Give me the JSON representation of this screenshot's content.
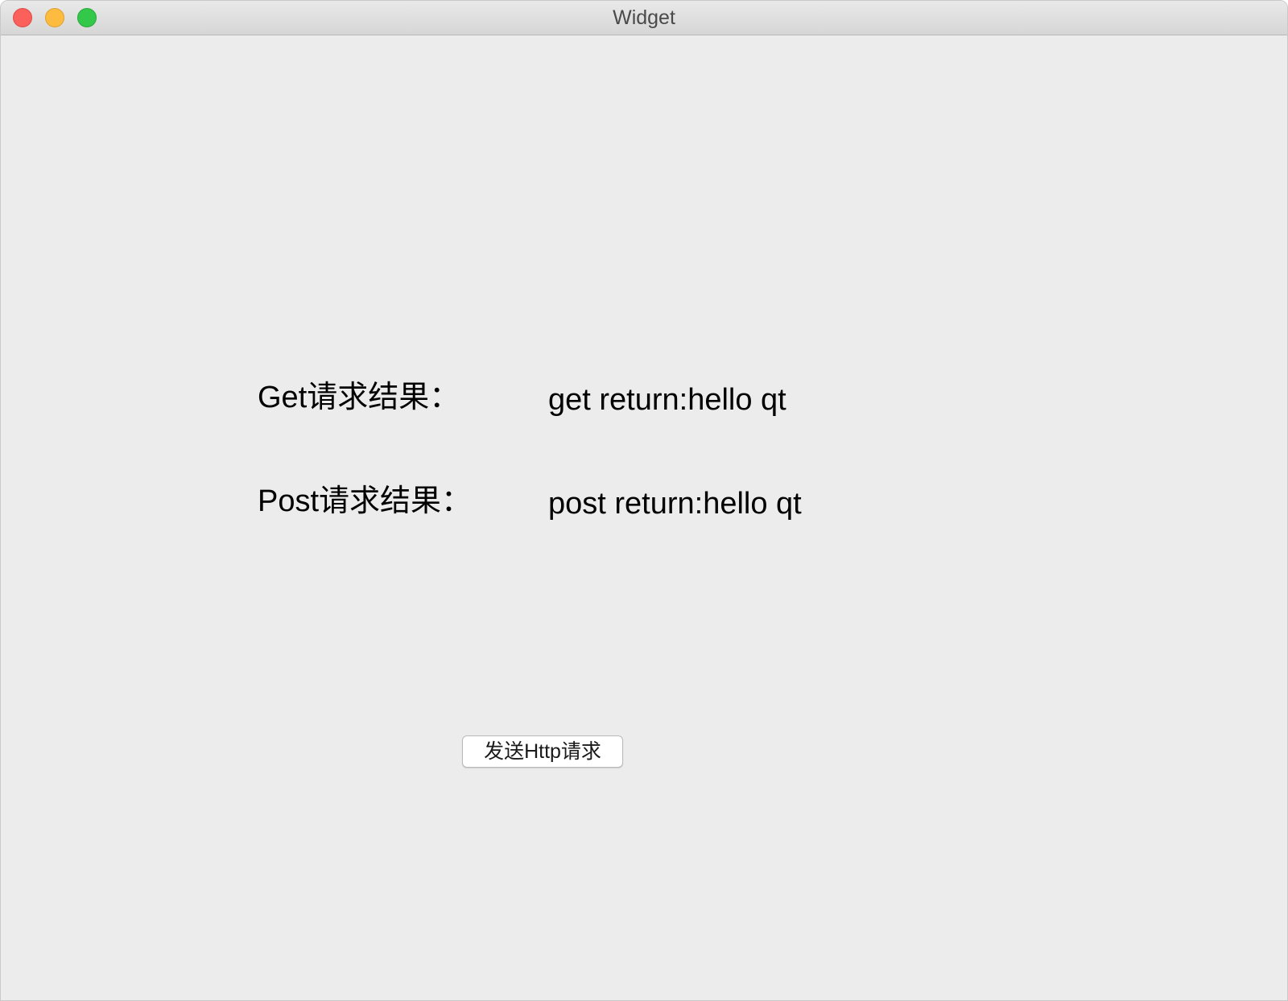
{
  "window": {
    "title": "Widget"
  },
  "results": {
    "get_label": "Get请求结果：",
    "get_value": "get return:hello qt",
    "post_label": "Post请求结果：",
    "post_value": "post return:hello qt"
  },
  "actions": {
    "send_button_label": "发送Http请求"
  },
  "colors": {
    "close": "#fc605b",
    "minimize": "#fdbc40",
    "zoom": "#34c84a",
    "window_background": "#ececec"
  }
}
